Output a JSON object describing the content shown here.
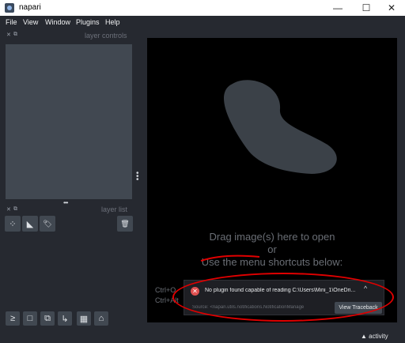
{
  "window": {
    "title": "napari",
    "minimize": "—",
    "maximize": "☐",
    "close": "✕"
  },
  "menu": {
    "items": [
      "File",
      "View",
      "Window",
      "Plugins",
      "Help"
    ]
  },
  "layer_controls": {
    "title": "layer controls"
  },
  "layer_list": {
    "title": "layer list"
  },
  "tools": {
    "points": "⁘",
    "shapes": "◣",
    "labels": "🏷",
    "delete": "🗑"
  },
  "bottom_buttons": {
    "console": "≥",
    "ndisplay": "□",
    "roll": "⧉",
    "transpose": "↳",
    "grid": "▦",
    "home": "⌂"
  },
  "canvas": {
    "welcome_line1": "Drag image(s) here to open",
    "welcome_line2": "or",
    "welcome_line3": "Use the menu shortcuts below:",
    "shortcut1": "Ctrl+O",
    "shortcut2": "Ctrl+Alt"
  },
  "notification": {
    "message": "No plugin found capable of reading C:\\Users\\Mini_1\\OneDri...",
    "source": "Source: <napari.utils.notifications.NotificationManage",
    "view_traceback": "View Traceback",
    "expand": "^"
  },
  "status": {
    "activity": "▲ activity"
  },
  "colors": {
    "background": "#262930",
    "panel": "#414851",
    "annotation": "#e00000"
  }
}
